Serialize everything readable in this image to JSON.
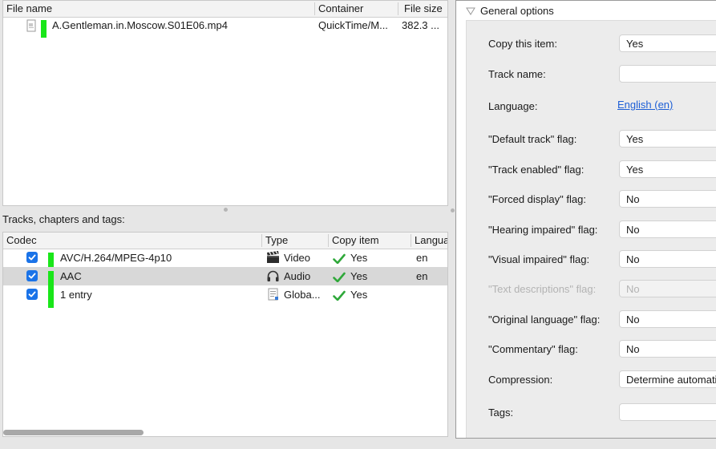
{
  "files": {
    "columns": [
      "File name",
      "Container",
      "File size"
    ],
    "rows": [
      {
        "name": "A.Gentleman.in.Moscow.S01E06.mp4",
        "container": "QuickTime/M...",
        "size": "382.3 ..."
      }
    ]
  },
  "tracks_label": "Tracks, chapters and tags:",
  "tracks": {
    "columns": [
      "Codec",
      "Type",
      "Copy item",
      "Langua"
    ],
    "rows": [
      {
        "codec": "AVC/H.264/MPEG-4p10",
        "type": "Video",
        "type_icon": "clapper-icon",
        "copy": "Yes",
        "language": "en",
        "checked": true,
        "selected": false
      },
      {
        "codec": "AAC",
        "type": "Audio",
        "type_icon": "headphones-icon",
        "copy": "Yes",
        "language": "en",
        "checked": true,
        "selected": true
      },
      {
        "codec": "1 entry",
        "type": "Globa...",
        "type_icon": "document-icon",
        "copy": "Yes",
        "language": "",
        "checked": true,
        "selected": false
      }
    ]
  },
  "options": {
    "section_title": "General options",
    "fields": {
      "copy_item": {
        "label": "Copy this item:",
        "value": "Yes"
      },
      "track_name": {
        "label": "Track name:",
        "value": ""
      },
      "language": {
        "label": "Language:",
        "value": "English (en)"
      },
      "default_track": {
        "label": "\"Default track\" flag:",
        "value": "Yes"
      },
      "track_enabled": {
        "label": "\"Track enabled\" flag:",
        "value": "Yes"
      },
      "forced_display": {
        "label": "\"Forced display\" flag:",
        "value": "No"
      },
      "hearing_impaired": {
        "label": "\"Hearing impaired\" flag:",
        "value": "No"
      },
      "visual_impaired": {
        "label": "\"Visual impaired\" flag:",
        "value": "No"
      },
      "text_descriptions": {
        "label": "\"Text descriptions\" flag:",
        "value": "No",
        "disabled": true
      },
      "original_language": {
        "label": "\"Original language\" flag:",
        "value": "No"
      },
      "commentary": {
        "label": "\"Commentary\" flag:",
        "value": "No"
      },
      "compression": {
        "label": "Compression:",
        "value": "Determine automatically"
      },
      "tags": {
        "label": "Tags:",
        "value": ""
      }
    }
  },
  "colors": {
    "track_indicator": "#19e619",
    "checkbox": "#1a73e8",
    "link": "#1d5fd6",
    "checkmark": "#2fa83a"
  }
}
